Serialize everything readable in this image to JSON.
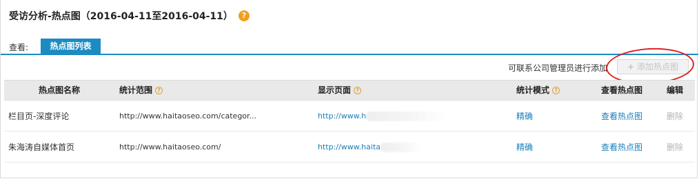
{
  "header": {
    "title": "受访分析-热点图（2016-04-11至2016-04-11）",
    "help_icon": "?"
  },
  "view": {
    "label": "查看:",
    "tabs": [
      {
        "label": "热点图列表",
        "active": true
      }
    ]
  },
  "toolbar": {
    "note": "可联系公司管理员进行添加",
    "add_button": {
      "icon": "plus-icon",
      "plus": "+",
      "label": "添加热点图",
      "disabled": true
    }
  },
  "table": {
    "columns": {
      "name": "热点图名称",
      "scope": "统计范围",
      "page": "显示页面",
      "mode": "统计模式",
      "view": "查看热点图",
      "edit": "编辑"
    },
    "help_mark": "?",
    "rows": [
      {
        "name": "栏目页-深度评论",
        "scope": "http://www.haitaoseo.com/categor...",
        "page": "http://www.h",
        "mode": "精确",
        "view": "查看热点图",
        "delete": "删除"
      },
      {
        "name": "朱海涛自媒体首页",
        "scope": "http://www.haitaoseo.com/",
        "page": "http://www.haita",
        "mode": "精确",
        "view": "查看热点图",
        "delete": "删除"
      }
    ]
  },
  "colors": {
    "accent": "#1b8bc2",
    "link": "#1a7fb8",
    "help": "#f0a020",
    "annotation": "#e02020"
  }
}
